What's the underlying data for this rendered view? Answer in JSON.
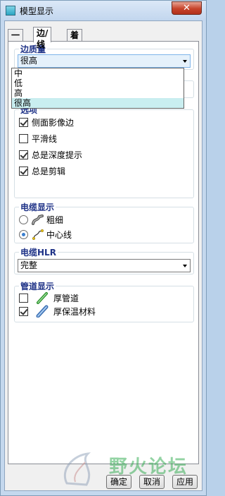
{
  "window": {
    "title": "模型显示",
    "close_glyph": "✕"
  },
  "tabs": [
    {
      "label": "一般",
      "active": false
    },
    {
      "label": "边/线",
      "active": true
    },
    {
      "label": "着色",
      "active": false
    }
  ],
  "edge_quality": {
    "label": "边质量",
    "selected": "很高",
    "options": [
      "中",
      "低",
      "高",
      "很高"
    ]
  },
  "options": {
    "label": "选项",
    "items": [
      {
        "label": "侧面影像边",
        "checked": true
      },
      {
        "label": "平滑线",
        "checked": false
      },
      {
        "label": "总是深度提示",
        "checked": true
      },
      {
        "label": "总是剪辑",
        "checked": true
      }
    ]
  },
  "cable_display": {
    "label": "电缆显示",
    "items": [
      {
        "label": "粗细",
        "selected": false,
        "icon": "thick-cable-icon"
      },
      {
        "label": "中心线",
        "selected": true,
        "icon": "centerline-cable-icon"
      }
    ]
  },
  "cable_hlr": {
    "label": "电缆HLR",
    "selected": "完整"
  },
  "pipe_display": {
    "label": "管道显示",
    "items": [
      {
        "label": "厚管道",
        "checked": false,
        "icon": "thick-pipe-icon"
      },
      {
        "label": "厚保温材料",
        "checked": true,
        "icon": "insulation-pipe-icon"
      }
    ]
  },
  "buttons": {
    "ok": "确定",
    "cancel": "取消",
    "apply": "应用"
  },
  "watermark": {
    "text": "野火论坛"
  },
  "colors": {
    "accent": "#1e3287",
    "selection": "#c9eef0",
    "titlebar": "#c4d8ee"
  }
}
